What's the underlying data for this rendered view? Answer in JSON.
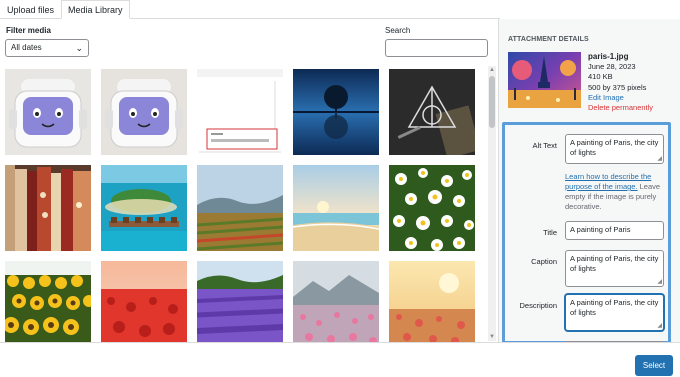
{
  "tabs": [
    {
      "label": "Upload files",
      "active": false
    },
    {
      "label": "Media Library",
      "active": true
    }
  ],
  "filter": {
    "label": "Filter media",
    "selected": "All dates"
  },
  "search": {
    "label": "Search",
    "placeholder": ""
  },
  "media_items": [
    {
      "name": "robot-face-1",
      "icon": "robot-image"
    },
    {
      "name": "robot-face-2",
      "icon": "robot-image"
    },
    {
      "name": "screenshot-form",
      "icon": "screenshot-image"
    },
    {
      "name": "lone-tree-reflection",
      "icon": "tree-image"
    },
    {
      "name": "deathly-hallows-art",
      "icon": "triangle-image"
    },
    {
      "name": "clothing-rack",
      "icon": "clothes-image"
    },
    {
      "name": "tropical-island",
      "icon": "island-image"
    },
    {
      "name": "vineyard-landscape",
      "icon": "vineyard-image"
    },
    {
      "name": "beach-sunset",
      "icon": "beach-image"
    },
    {
      "name": "daisy-field",
      "icon": "daisy-image"
    },
    {
      "name": "sunflower-field",
      "icon": "sunflower-image"
    },
    {
      "name": "red-poppy-field",
      "icon": "poppy-image"
    },
    {
      "name": "lavender-field",
      "icon": "lavender-image"
    },
    {
      "name": "mountain-flower-meadow",
      "icon": "meadow-image"
    },
    {
      "name": "sunset-flowers",
      "icon": "flowers-image"
    }
  ],
  "attachment": {
    "header": "ATTACHMENT DETAILS",
    "filename": "paris-1.jpg",
    "date": "June 28, 2023",
    "size": "410 KB",
    "dimensions": "500 by 375 pixels",
    "edit_link": "Edit Image",
    "delete_link": "Delete permanently"
  },
  "fields": {
    "alt_text": {
      "label": "Alt Text",
      "value": "A painting of Paris, the city of lights"
    },
    "help": {
      "link": "Learn how to describe the purpose of the image.",
      "text": " Leave empty if the image is purely decorative."
    },
    "title": {
      "label": "Title",
      "value": "A painting of Paris"
    },
    "caption": {
      "label": "Caption",
      "value": "A painting of Paris, the city of lights"
    },
    "description": {
      "label": "Description",
      "value": "A painting of Paris, the city of lights"
    }
  },
  "footer": {
    "select_label": "Select"
  },
  "colors": {
    "accent": "#2271b1",
    "highlight_border": "#5b9dd9",
    "danger": "#d63638"
  }
}
